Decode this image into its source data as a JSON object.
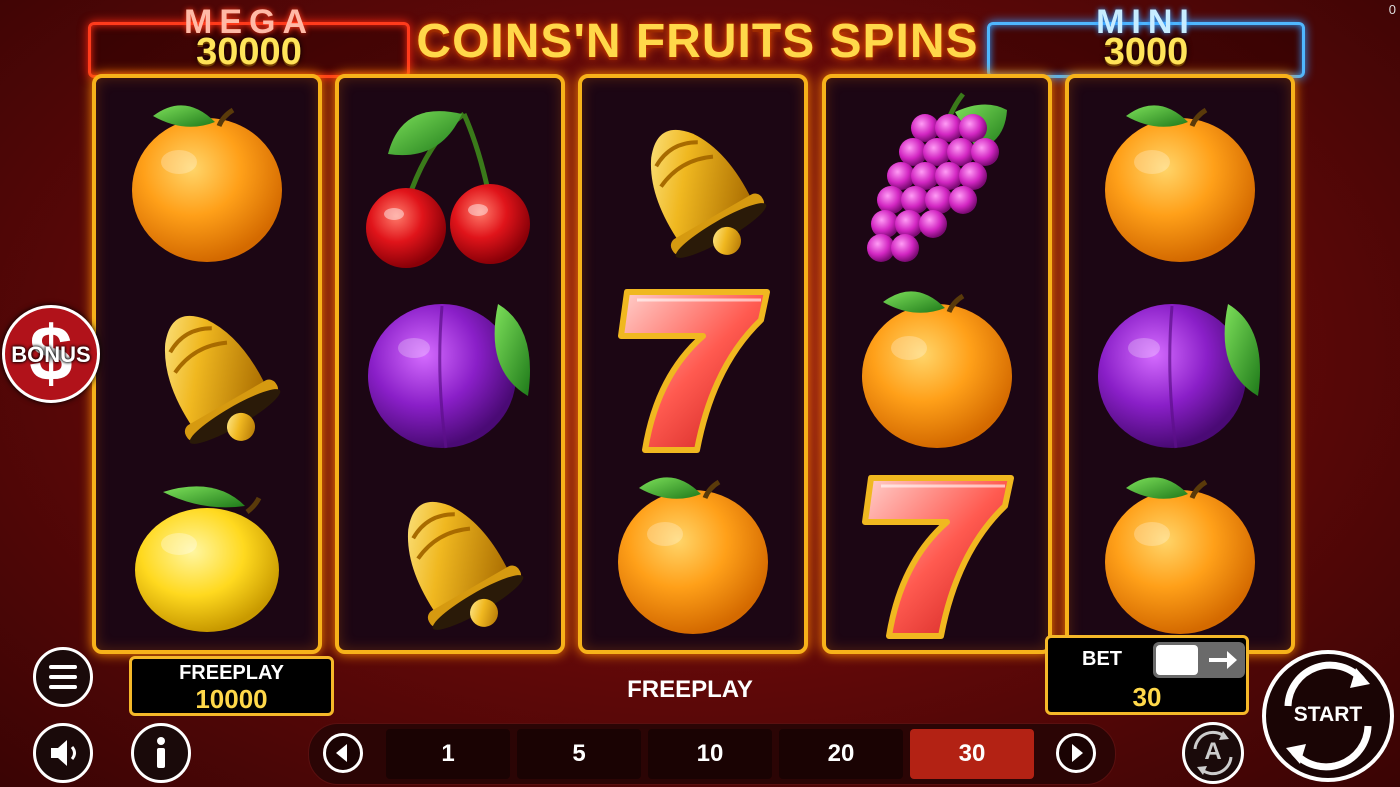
{
  "jackpots": {
    "mega": {
      "label": "MEGA",
      "value": "30000"
    },
    "mini": {
      "label": "MINI",
      "value": "3000"
    }
  },
  "game_title": "COINS'N FRUITS SPINS",
  "corner_counter": "0",
  "reels": [
    [
      "orange",
      "bell",
      "lemon"
    ],
    [
      "cherries",
      "plum",
      "bell"
    ],
    [
      "bell",
      "seven",
      "orange"
    ],
    [
      "grapes",
      "orange",
      "seven"
    ],
    [
      "orange",
      "plum",
      "orange"
    ]
  ],
  "bonus_button": {
    "label": "BONUS",
    "symbol": "$"
  },
  "freeplay_panel": {
    "label": "FREEPLAY",
    "value": "10000"
  },
  "status_text": "FREEPLAY",
  "bet_panel": {
    "label": "BET",
    "value": "30"
  },
  "bet_options": [
    "1",
    "5",
    "10",
    "20",
    "30"
  ],
  "selected_bet": "30",
  "start_button": {
    "label": "START"
  },
  "autoplay_button": {
    "label": "A"
  },
  "icons": [
    "menu-icon",
    "sound-icon",
    "info-icon",
    "arrow-left-icon",
    "arrow-right-icon",
    "autoplay-icon",
    "start-icon"
  ],
  "colors": {
    "reel_border": "#f7b21a",
    "mega": "#ff3b1c",
    "mini": "#4fb7ff",
    "value_yellow": "#ffd84a",
    "selected_bet": "#b32214"
  }
}
